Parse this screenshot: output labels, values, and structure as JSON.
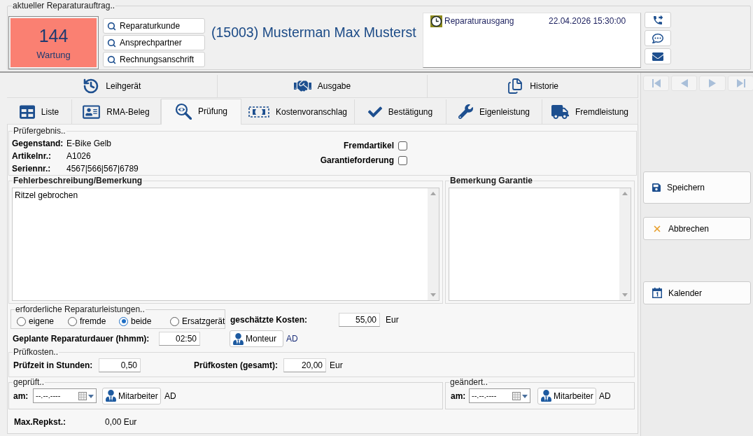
{
  "order": {
    "legend": "aktueller Reparaturauftrag..",
    "status": {
      "number": "144",
      "label": "Wartung"
    },
    "lookup_buttons": [
      "Reparaturkunde",
      "Ansprechpartner",
      "Rechnungsanschrift"
    ],
    "customer_title": "(15003) Musterman Max Musterst",
    "events": [
      {
        "label": "Reparaturausgang",
        "datetime": "22.04.2026 15:30:00"
      }
    ]
  },
  "tabs_upper": [
    {
      "label": "Leihgerät",
      "kind": "loan",
      "selected": false
    },
    {
      "label": "Ausgabe",
      "kind": "handover",
      "selected": false
    },
    {
      "label": "Historie",
      "kind": "history",
      "selected": false
    }
  ],
  "tabs": [
    {
      "label": "Liste",
      "kind": "list",
      "selected": false
    },
    {
      "label": "RMA-Beleg",
      "kind": "document",
      "selected": false
    },
    {
      "label": "Prüfung",
      "kind": "inspection",
      "selected": true
    },
    {
      "label": "Kostenvoranschlag",
      "kind": "estimate",
      "selected": false
    },
    {
      "label": "Bestätigung",
      "kind": "confirmation",
      "selected": false
    },
    {
      "label": "Eigenleistung",
      "kind": "own_work",
      "selected": false
    },
    {
      "label": "Fremdleistung",
      "kind": "external_work",
      "selected": false
    }
  ],
  "inspection_result": {
    "legend": "Prüfergebnis..",
    "fields": [
      {
        "label": "Gegenstand:",
        "value": "E-Bike Gelb"
      },
      {
        "label": "Artikelnr.:",
        "value": "A1026"
      },
      {
        "label": "Seriennr.:",
        "value": "4567|566|567|6789"
      }
    ],
    "checkboxes": [
      {
        "label": "Fremdartikel",
        "checked": false
      },
      {
        "label": "Garantieforderung",
        "checked": false
      }
    ]
  },
  "fault_description": {
    "legend": "Fehlerbeschreibung/Bemerkung",
    "value": "Ritzel gebrochen"
  },
  "warranty_remark": {
    "legend": "Bemerkung Garantie"
  },
  "required_services": {
    "legend": "erforderliche Reparaturleistungen..",
    "options": [
      {
        "label": "eigene",
        "selected": false
      },
      {
        "label": "fremde",
        "selected": false
      },
      {
        "label": "beide",
        "selected": true
      },
      {
        "label": "Ersatzgerät",
        "selected": false
      }
    ]
  },
  "estimated_costs": {
    "label": "geschätzte Kosten:",
    "value": "55,00",
    "unit": "Eur"
  },
  "planned_duration": {
    "label": "Geplante Reparaturdauer (hhmm):",
    "value": "02:50",
    "button": "Monteur",
    "assignee": "AD"
  },
  "inspection_costs": {
    "legend": "Prüfkosten..",
    "hours_label": "Prüfzeit in Stunden:",
    "hours_value": "0,50",
    "total_label": "Prüfkosten (gesamt):",
    "total_value": "20,00",
    "unit": "Eur"
  },
  "checked_by": {
    "legend": "geprüft..",
    "date_label": "am:",
    "date_value": "--.--.----",
    "button": "Mitarbeiter",
    "assignee": "AD"
  },
  "changed_by": {
    "legend": "geändert..",
    "date_label": "am:",
    "date_value": "--.--.----",
    "button": "Mitarbeiter",
    "assignee": "AD"
  },
  "max_repair_costs": {
    "label": "Max.Repkst.:",
    "value": "0,00 Eur"
  },
  "record_navigation": [
    {
      "kind": "first",
      "disabled": true
    },
    {
      "kind": "previous",
      "disabled": true
    },
    {
      "kind": "next",
      "disabled": true
    },
    {
      "kind": "last",
      "disabled": true
    }
  ],
  "actions": [
    {
      "kind": "save",
      "label": "Speichern"
    },
    {
      "kind": "cancel",
      "label": "Abbrechen"
    },
    {
      "kind": "calendar",
      "label": "Kalender"
    }
  ]
}
